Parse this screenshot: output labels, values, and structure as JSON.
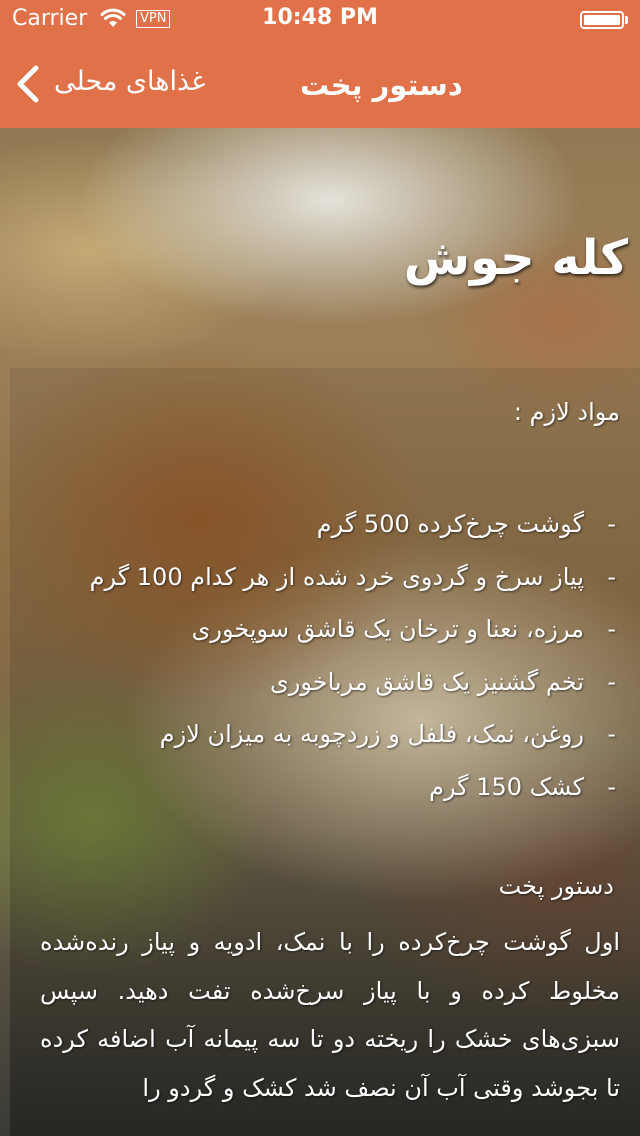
{
  "status_bar": {
    "carrier": "Carrier",
    "vpn": "VPN",
    "time": "10:48 PM",
    "battery_level": 1.0
  },
  "nav": {
    "back_label": "غذاهای محلی",
    "title": "دستور پخت"
  },
  "recipe": {
    "title": "کله جوش",
    "ingredients_label": "مواد لازم :",
    "ingredients": [
      "گوشت چرخ‌کرده 500 گرم",
      "پیاز سرخ و گردوی خرد شده از هر کدام 100 گرم",
      "مرزه، نعنا و ترخان یک قاشق سوپخوری",
      "تخم گشنیز یک قاشق مرباخوری",
      "روغن، نمک، فلفل و زردچوبه به میزان لازم",
      "کشک 150 گرم"
    ],
    "ingredient_bullet": "-",
    "method_label": "دستور پخت",
    "method_text": "اول گوشت چرخ‌کرده را با نمک، ادویه و پیاز رنده‌شده مخلوط کرده و با پیاز سرخ‌شده تفت دهید. سپس سبزی‌های خشک را ریخته دو تا سه پیمانه آب اضافه کرده تا بجوشد وقتی آب آن نصف شد کشک و گردو را"
  },
  "colors": {
    "accent": "#e07148",
    "text": "#ffffff"
  },
  "icons": {
    "back": "chevron-left-icon",
    "wifi": "wifi-icon",
    "battery": "battery-icon"
  }
}
